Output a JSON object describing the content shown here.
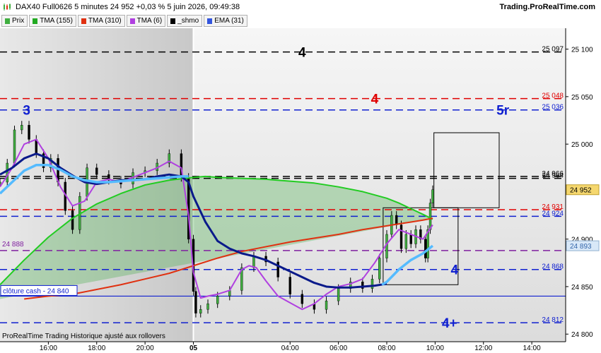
{
  "header": {
    "title": "DAX40 Full0626 5 minutes 24 952 +0,03 % 5 juin 2026, 09:49:38",
    "brand": "Trading.ProRealTime.com",
    "footer": "ProRealTime Trading  Historique ajusté aux rollovers"
  },
  "legend": [
    {
      "label": "Prix",
      "color": "#3fae3f"
    },
    {
      "label": "TMA (155)",
      "color": "#22aa22"
    },
    {
      "label": "TMA (310)",
      "color": "#e03010"
    },
    {
      "label": "TMA (6)",
      "color": "#b040e0"
    },
    {
      "label": "_shmo",
      "color": "#000000"
    },
    {
      "label": "EMA (31)",
      "color": "#3355dd"
    }
  ],
  "colors": {
    "black": "#000000",
    "red": "#e00000",
    "blue": "#1020d0",
    "purple": "#8020a0"
  },
  "chart_data": {
    "type": "line",
    "ylim": [
      24792,
      25122
    ],
    "yticks": [
      24800,
      24850,
      24900,
      24950,
      25000,
      25050,
      25100
    ],
    "ytick_labels": [
      "24 800",
      "24 850",
      "24 900",
      "24 950",
      "25 000",
      "25 050",
      "25 100"
    ],
    "xticks": [
      {
        "x": 16,
        "label": "16:00",
        "bold": false
      },
      {
        "x": 18,
        "label": "18:00",
        "bold": false
      },
      {
        "x": 20,
        "label": "20:00",
        "bold": false
      },
      {
        "x": 22,
        "label": "05",
        "bold": true
      },
      {
        "x": 26,
        "label": "04:00",
        "bold": false
      },
      {
        "x": 28,
        "label": "06:00",
        "bold": false
      },
      {
        "x": 30,
        "label": "08:00",
        "bold": false
      },
      {
        "x": 32,
        "label": "10:00",
        "bold": false
      },
      {
        "x": 34,
        "label": "12:00",
        "bold": false
      },
      {
        "x": 36,
        "label": "14:00",
        "bold": false
      }
    ],
    "levels": [
      {
        "value": 25097,
        "color": "black",
        "label": "25 097"
      },
      {
        "value": 25048,
        "color": "red",
        "label": "25 048"
      },
      {
        "value": 25036,
        "color": "blue",
        "label": "25 036"
      },
      {
        "value": 24966,
        "color": "black",
        "label": "24 966"
      },
      {
        "value": 24964,
        "color": "black",
        "label": "24 964"
      },
      {
        "value": 24931,
        "color": "red",
        "label": "24 931"
      },
      {
        "value": 24924,
        "color": "blue",
        "label": "24 924"
      },
      {
        "value": 24888,
        "color": "purple",
        "label": ""
      },
      {
        "value": 24868,
        "color": "blue",
        "label": "24 868"
      },
      {
        "value": 24812,
        "color": "blue",
        "label": "24 812"
      }
    ],
    "left_labels": [
      {
        "value": 24888,
        "text": "24 888"
      }
    ],
    "annotations": [
      {
        "text": "4",
        "x": 26.5,
        "y": 25097,
        "color": "black"
      },
      {
        "text": "4",
        "x": 29.5,
        "y": 25048,
        "color": "red"
      },
      {
        "text": "3",
        "x": 15.1,
        "y": 25036,
        "color": "blue"
      },
      {
        "text": "5r",
        "x": 34.8,
        "y": 25036,
        "color": "blue"
      },
      {
        "text": "4",
        "x": 32.8,
        "y": 24868,
        "color": "blue"
      },
      {
        "text": "4+",
        "x": 32.6,
        "y": 24812,
        "color": "blue"
      }
    ],
    "close_cash": {
      "value": 24840,
      "label": "clôture cash -  24 840"
    },
    "current_price": {
      "value": 24952,
      "label": "24 952"
    },
    "ema_last": {
      "value": 24893,
      "label": "24 893"
    },
    "boxes": [
      {
        "x0": 29.85,
        "x1": 32.95,
        "y0": 24852,
        "y1": 24933
      },
      {
        "x0": 31.95,
        "x1": 34.65,
        "y0": 24933,
        "y1": 25012
      }
    ],
    "series": [
      {
        "name": "Prix",
        "x": [
          14.0,
          14.3,
          14.6,
          14.9,
          15.2,
          15.5,
          15.8,
          16.1,
          16.4,
          16.7,
          17.0,
          17.3,
          17.6,
          18.0,
          18.5,
          19.0,
          19.5,
          20.0,
          20.5,
          21.0,
          21.5,
          21.8,
          22.0,
          22.1,
          22.3,
          22.6,
          23.0,
          23.5,
          24.0,
          24.5,
          25.0,
          25.5,
          26.0,
          26.5,
          27.0,
          27.5,
          28.0,
          28.5,
          29.0,
          29.4,
          29.7,
          30.0,
          30.2,
          30.4,
          30.6,
          30.8,
          31.0,
          31.2,
          31.4,
          31.6,
          31.7,
          31.8,
          31.9
        ],
        "y": [
          24960,
          24980,
          25015,
          25020,
          25005,
          24990,
          24975,
          24985,
          24960,
          24930,
          24910,
          24945,
          24975,
          24968,
          24962,
          24958,
          24970,
          24972,
          24980,
          24990,
          24965,
          24900,
          24845,
          24822,
          24826,
          24832,
          24840,
          24846,
          24870,
          24882,
          24876,
          24860,
          24842,
          24832,
          24826,
          24835,
          24848,
          24855,
          24848,
          24858,
          24880,
          24905,
          24925,
          24915,
          24890,
          24905,
          24895,
          24910,
          24900,
          24880,
          24910,
          24938,
          24952
        ]
      },
      {
        "name": "TMA (155)",
        "x": [
          14.0,
          15.0,
          16.0,
          17.0,
          18.0,
          19.0,
          20.0,
          21.0,
          22.0,
          22.5,
          23.0,
          24.0,
          25.0,
          26.0,
          27.0,
          28.0,
          29.0,
          30.0,
          30.5,
          31.0,
          31.5,
          31.9
        ],
        "y": [
          24852,
          24878,
          24902,
          24922,
          24937,
          24948,
          24957,
          24962,
          24965,
          24966,
          24965,
          24964,
          24963,
          24961,
          24959,
          24955,
          24950,
          24943,
          24938,
          24932,
          24926,
          24921
        ]
      },
      {
        "name": "TMA (310)",
        "x": [
          15.0,
          16.0,
          17.0,
          18.0,
          19.0,
          20.0,
          21.0,
          22.0,
          23.0,
          24.0,
          25.0,
          26.0,
          27.0,
          28.0,
          29.0,
          30.0,
          30.5,
          31.0,
          31.5,
          31.9
        ],
        "y": [
          24837,
          24840,
          24842,
          24847,
          24852,
          24858,
          24864,
          24872,
          24880,
          24887,
          24892,
          24897,
          24901,
          24905,
          24910,
          24914,
          24916,
          24918,
          24920,
          24922
        ]
      },
      {
        "name": "TMA (6)",
        "x": [
          14.0,
          14.5,
          15.0,
          15.5,
          16.0,
          16.5,
          17.0,
          17.5,
          18.0,
          18.5,
          19.0,
          19.5,
          20.0,
          20.5,
          21.0,
          21.5,
          21.8,
          22.0,
          22.3,
          22.6,
          23.0,
          23.5,
          24.0,
          24.3,
          24.6,
          25.0,
          25.5,
          26.0,
          26.5,
          27.0,
          27.5,
          28.0,
          28.5,
          29.0,
          29.5,
          30.0,
          30.5,
          31.0,
          31.5,
          31.9
        ],
        "y": [
          24955,
          24975,
          25000,
          25005,
          24985,
          24955,
          24935,
          24940,
          24960,
          24963,
          24960,
          24965,
          24970,
          24975,
          24982,
          24975,
          24925,
          24865,
          24838,
          24840,
          24842,
          24846,
          24868,
          24872,
          24870,
          24856,
          24840,
          24833,
          24826,
          24832,
          24842,
          24850,
          24853,
          24858,
          24875,
          24895,
          24910,
          24905,
          24900,
          24915
        ]
      },
      {
        "name": "_shmo",
        "x": [
          14.0,
          14.5,
          15.0,
          15.5,
          16.0,
          16.5,
          17.0,
          17.5,
          18.0,
          18.5,
          19.0,
          19.5,
          20.0,
          20.5,
          21.0,
          21.5,
          21.8,
          22.0,
          22.5,
          23.0,
          23.5,
          24.0,
          24.5,
          25.0,
          25.5,
          26.0,
          26.5,
          27.0,
          27.5,
          28.0,
          28.5,
          29.0,
          29.5,
          30.0
        ],
        "y": [
          24968,
          24975,
          24985,
          24990,
          24985,
          24975,
          24967,
          24960,
          24958,
          24960,
          24962,
          24962,
          24963,
          24966,
          24968,
          24966,
          24960,
          24945,
          24918,
          24898,
          24890,
          24885,
          24882,
          24878,
          24872,
          24866,
          24860,
          24854,
          24850,
          24849,
          24849,
          24850,
          24851,
          24853
        ]
      },
      {
        "name": "EMA (31)",
        "x": [
          14.0,
          14.5,
          15.0,
          15.5,
          16.0,
          16.5,
          17.0,
          17.5,
          18.0,
          18.5,
          19.0,
          19.5,
          20.0,
          20.5,
          21.0,
          21.5,
          21.8,
          29.8,
          30.0,
          30.5,
          31.0,
          31.5,
          31.9
        ],
        "y": [
          24948,
          24960,
          24972,
          24978,
          24978,
          24973,
          24966,
          24962,
          24960,
          24960,
          24961,
          24962,
          24963,
          24964,
          24965,
          24966,
          24966,
          24852,
          24855,
          24868,
          24878,
          24885,
          24893
        ]
      }
    ]
  }
}
